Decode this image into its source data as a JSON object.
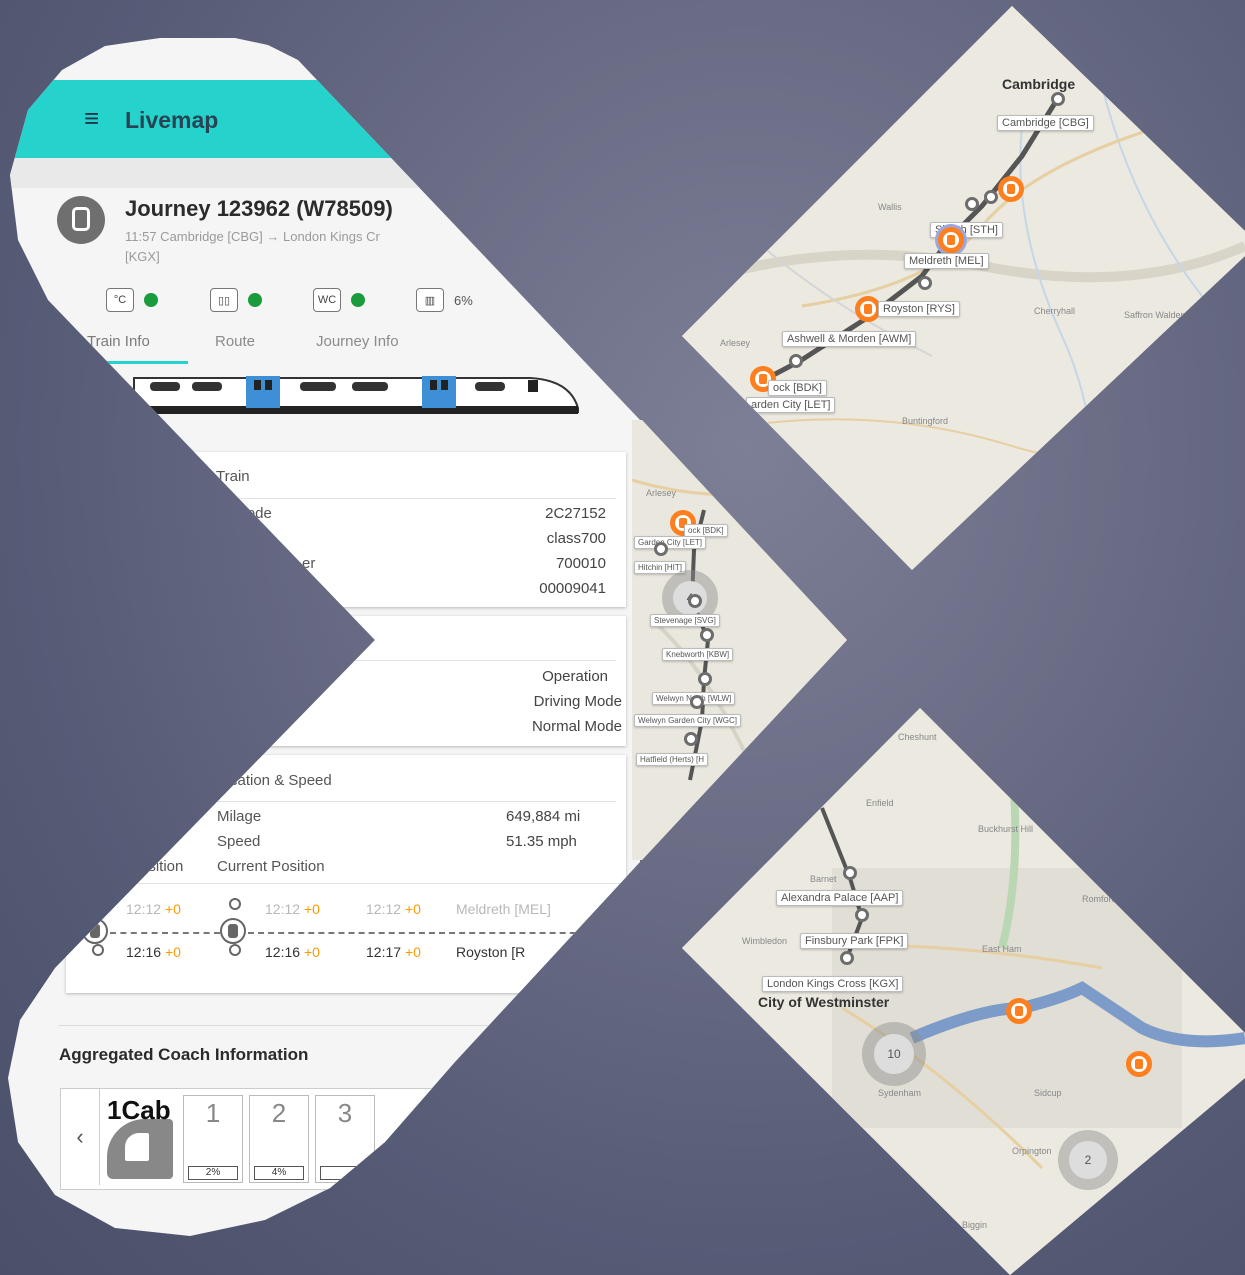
{
  "app": {
    "title": "Livemap",
    "menu_icon": "hamburger-menu-icon",
    "accent": "#26d3cc"
  },
  "journey": {
    "title": "Journey 123962 (W78509)",
    "subtitle": "11:57 Cambridge [CBG] → London Kings Cr",
    "subtitle_cont": "[KGX]",
    "status": [
      {
        "icon": "temperature-icon",
        "text": "°C",
        "status_color": "#1b9c3c"
      },
      {
        "icon": "doors-icon",
        "text": "",
        "status_color": "#1b9c3c"
      },
      {
        "icon": "wc-icon",
        "text": "WC",
        "status_color": "#1b9c3c"
      },
      {
        "icon": "occupancy-icon",
        "text": "",
        "value": "6%"
      }
    ]
  },
  "tabs": [
    "Train Info",
    "Route",
    "Journey Info"
  ],
  "train_card": {
    "header": "Train",
    "rows": [
      {
        "label": "lcode",
        "value": "2C27152"
      },
      {
        "label": "e",
        "value": "class700"
      },
      {
        "label": "er",
        "value": "700010"
      },
      {
        "label": "",
        "value": "00009041"
      }
    ]
  },
  "operation_card": {
    "rows": [
      {
        "value": "Operation"
      },
      {
        "value": "Driving Mode"
      },
      {
        "value": "Normal Mode"
      }
    ]
  },
  "location_card": {
    "header": "cation & Speed",
    "rows": [
      {
        "label": "Milage",
        "value": "649,884 mi"
      },
      {
        "label": "Speed",
        "value": "51.35 mph"
      }
    ],
    "position_label_left": "osition",
    "position_label": "Current Position"
  },
  "timeline": {
    "row1": {
      "t1": "12:12",
      "d1": "+0",
      "t2": "12:12",
      "d2": "+0",
      "t3": "12:12",
      "d3": "+0",
      "station": "Meldreth [MEL]"
    },
    "row2": {
      "t1": "12:16",
      "d1": "+0",
      "t2": "12:16",
      "d2": "+0",
      "t3": "12:17",
      "d3": "+0",
      "station": "Royston [R"
    }
  },
  "coaches": {
    "title": "Aggregated Coach Information",
    "prev": "‹",
    "cab_label": "1Cab",
    "items": [
      {
        "num": "1",
        "occupancy": "2%"
      },
      {
        "num": "2",
        "occupancy": "4%"
      },
      {
        "num": "3",
        "occupancy": ""
      }
    ]
  },
  "map_north": {
    "city": "Cambridge",
    "places": [
      "Wallis",
      "Arlesey",
      "Saffron Walden",
      "Buntingford",
      "Cherryhall"
    ],
    "labels": [
      "Cambridge [CBG]",
      "Sh        eth [STH]",
      "Meldreth [MEL]",
      "Royston [RYS]",
      "Ashwell & Morden [AWM]",
      "ock [BDK]",
      "arden City [LET]"
    ]
  },
  "map_middle": {
    "places": [
      "Arlesey"
    ],
    "labels": [
      "ock [BDK]",
      "Garden City [LET]",
      "Hitchin [HIT]",
      "Stevenage [SVG]",
      "Knebworth [KBW]",
      "Welwyn North [WLW]",
      "Welwyn Garden City [WGC]",
      "Hatfield (Herts) [H"
    ]
  },
  "map_south": {
    "city": "City of Westminster",
    "places": [
      "Cheshunt",
      "Enfield",
      "Buckhurst Hill",
      "Barnet",
      "Romford",
      "East Ham",
      "Wimbledon",
      "Sydenham",
      "Sidcup",
      "Orpington",
      "Biggin"
    ],
    "labels": [
      "Alexandra Palace [AAP]",
      "Finsbury Park [FPK]",
      "London Kings Cross [KGX]"
    ],
    "clusters": [
      "10",
      "2"
    ]
  }
}
